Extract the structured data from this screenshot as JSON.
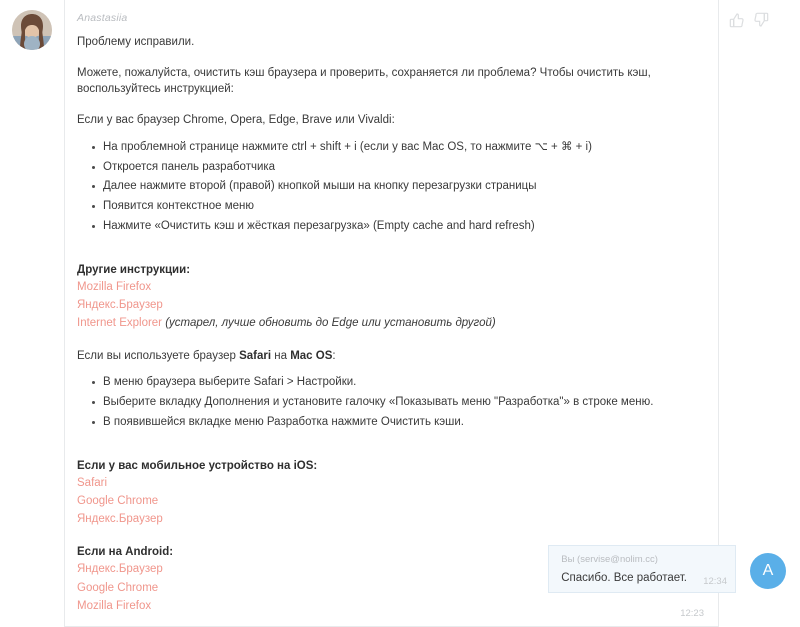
{
  "colors": {
    "link": "#f0968c",
    "user_avatar_bg": "#5aafe8",
    "reply_bubble_bg": "#f3f8fc",
    "card_border": "#e8eaec",
    "timestamp": "#c6c9cc"
  },
  "agent_message": {
    "author": "Anastasiia",
    "avatar_name": "agent-avatar-photo",
    "timestamp": "12:23",
    "intro": "Проблему исправили.",
    "request": "Можете, пожалуйста, очистить кэш браузера и проверить, сохраняется ли проблема? Чтобы очистить кэш, воспользуйтесь инструкцией:",
    "chrome_heading": "Если у вас браузер Chrome, Opera, Edge, Brave или Vivaldi:",
    "chrome_steps": [
      "На проблемной странице нажмите ctrl + shift + i (если у вас Mac OS, то нажмите ⌥ + ⌘ + i)",
      "Откроется панель разработчика",
      "Далее нажмите второй (правой) кнопкой мыши на кнопку перезагрузки страницы",
      "Появится контекстное меню",
      "Нажмите «Очистить кэш и жёсткая перезагрузка» (Empty cache and hard refresh)"
    ],
    "other_instructions_heading": "Другие инструкции:",
    "other_instructions_links": [
      "Mozilla Firefox",
      "Яндекс.Браузер",
      "Internet Explorer"
    ],
    "ie_note": " (устарел, лучше обновить до Edge или установить другой)",
    "safari_heading_prefix": "Если вы используете браузер ",
    "safari_heading_bold1": "Safari",
    "safari_heading_mid": " на ",
    "safari_heading_bold2": "Mac OS",
    "safari_heading_suffix": ":",
    "safari_steps": [
      "В меню браузера выберите Safari > Настройки.",
      "Выберите вкладку Дополнения и установите галочку «Показывать меню \"Разработка\"» в строке меню.",
      "В появившейся вкладке меню Разработка нажмите Очистить кэши."
    ],
    "ios_heading": "Если у вас мобильное устройство на iOS:",
    "ios_links": [
      "Safari",
      "Google Chrome",
      "Яндекс.Браузер"
    ],
    "android_heading": "Если на Android:",
    "android_links": [
      "Яндекс.Браузер",
      "Google Chrome",
      "Mozilla Firefox"
    ]
  },
  "reactions": {
    "thumbs_up_name": "thumbs-up-icon",
    "thumbs_down_name": "thumbs-down-icon"
  },
  "user_message": {
    "author": "Вы (servise@nolim.cc)",
    "text": "Спасибо. Все работает.",
    "timestamp": "12:34",
    "avatar_initial": "A"
  }
}
